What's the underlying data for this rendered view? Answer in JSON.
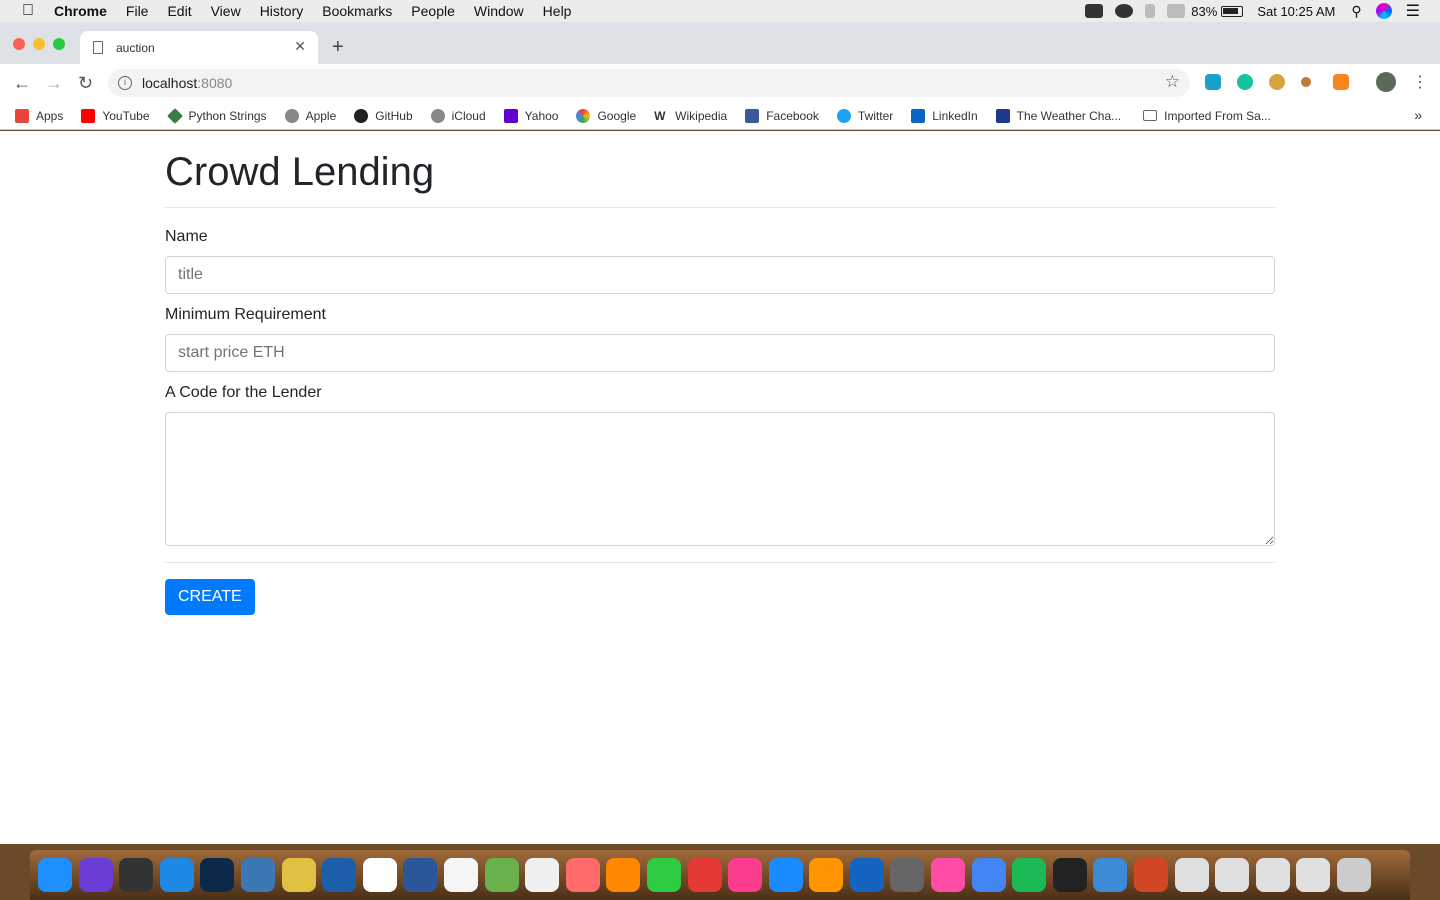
{
  "menubar": {
    "app_name": "Chrome",
    "menus": [
      "File",
      "Edit",
      "View",
      "History",
      "Bookmarks",
      "People",
      "Window",
      "Help"
    ],
    "battery": "83%",
    "clock": "Sat 10:25 AM"
  },
  "browser": {
    "tab_title": "auction",
    "url_host": "localhost",
    "url_port": ":8080"
  },
  "bookmarks": [
    {
      "label": "Apps",
      "color": "#e8453c"
    },
    {
      "label": "YouTube",
      "color": "#ff0000"
    },
    {
      "label": "Python Strings",
      "color": "#3a7d44"
    },
    {
      "label": "Apple",
      "color": "#888888"
    },
    {
      "label": "GitHub",
      "color": "#222222"
    },
    {
      "label": "iCloud",
      "color": "#888888"
    },
    {
      "label": "Yahoo",
      "color": "#5f01d1"
    },
    {
      "label": "Google",
      "color": "#4285f4"
    },
    {
      "label": "Wikipedia",
      "color": "#333333"
    },
    {
      "label": "Facebook",
      "color": "#3b5998"
    },
    {
      "label": "Twitter",
      "color": "#1da1f2"
    },
    {
      "label": "LinkedIn",
      "color": "#0a66c2"
    },
    {
      "label": "The Weather Cha...",
      "color": "#1b3a8a"
    },
    {
      "label": "Imported From Sa...",
      "color": "#777777"
    }
  ],
  "page": {
    "title": "Crowd Lending",
    "fields": {
      "name_label": "Name",
      "name_placeholder": "title",
      "min_label": "Minimum Requirement",
      "min_placeholder": "start price ETH",
      "code_label": "A Code for the Lender"
    },
    "create_button": "CREATE"
  },
  "dock": {
    "icons": [
      "#1e90ff",
      "#6a3dd6",
      "#333333",
      "#1e88e5",
      "#0b2a4a",
      "#3c78b4",
      "#e0c040",
      "#1c5fa8",
      "#ffffff",
      "#2b579a",
      "#f5f5f5",
      "#6ab04c",
      "#f0f0f0",
      "#ff6b6b",
      "#ff8800",
      "#2ecc40",
      "#e53935",
      "#fc3c8c",
      "#1a8cff",
      "#ff9500",
      "#1565c0",
      "#666666",
      "#ff4da6",
      "#4285f4",
      "#1db954",
      "#222222",
      "#3d8bd6",
      "#d24726",
      "#e0e0e0",
      "#e0e0e0",
      "#e0e0e0",
      "#e0e0e0",
      "#cccccc"
    ]
  }
}
